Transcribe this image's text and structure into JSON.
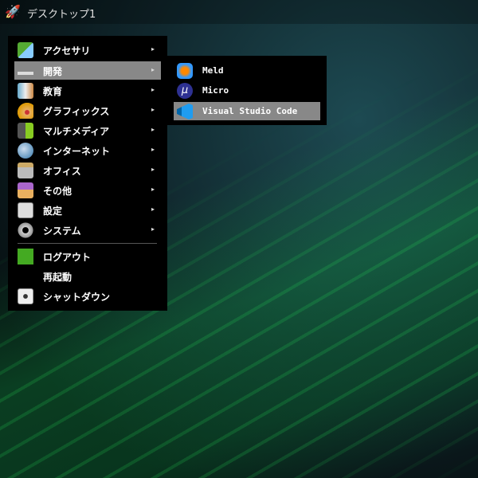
{
  "topbar": {
    "title": "デスクトップ1",
    "icon": "rocket-icon"
  },
  "main_menu": {
    "items": [
      {
        "label": "アクセサリ",
        "icon": "accessories-icon",
        "submenu": true
      },
      {
        "label": "開発",
        "icon": "development-icon",
        "submenu": true,
        "selected": true
      },
      {
        "label": "教育",
        "icon": "education-icon",
        "submenu": true
      },
      {
        "label": "グラフィックス",
        "icon": "graphics-icon",
        "submenu": true
      },
      {
        "label": "マルチメディア",
        "icon": "multimedia-icon",
        "submenu": true
      },
      {
        "label": "インターネット",
        "icon": "internet-icon",
        "submenu": true
      },
      {
        "label": "オフィス",
        "icon": "office-icon",
        "submenu": true
      },
      {
        "label": "その他",
        "icon": "other-icon",
        "submenu": true
      },
      {
        "label": "設定",
        "icon": "settings-icon",
        "submenu": true
      },
      {
        "label": "システム",
        "icon": "system-icon",
        "submenu": true
      }
    ],
    "session": [
      {
        "label": "ログアウト",
        "icon": "logout-icon"
      },
      {
        "label": "再起動"
      },
      {
        "label": "シャットダウン",
        "icon": "shutdown-icon"
      }
    ],
    "arrow": "▸"
  },
  "sub_menu": {
    "items": [
      {
        "label": "Meld",
        "icon": "meld-icon"
      },
      {
        "label": "Micro",
        "icon": "micro-icon",
        "glyph": "μ"
      },
      {
        "label": "Visual Studio Code",
        "icon": "vscode-icon",
        "selected": true
      }
    ]
  },
  "colors": {
    "selected": "#888888",
    "menu_bg": "#000000"
  }
}
